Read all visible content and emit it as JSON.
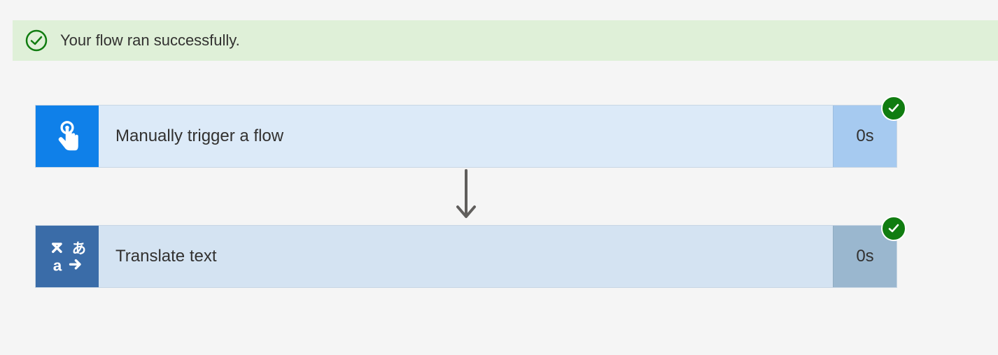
{
  "banner": {
    "message": "Your flow ran successfully."
  },
  "steps": [
    {
      "label": "Manually trigger a flow",
      "duration": "0s",
      "status": "success"
    },
    {
      "label": "Translate text",
      "duration": "0s",
      "status": "success"
    }
  ],
  "colors": {
    "success_green": "#107c10",
    "banner_bg": "#dff0d8",
    "card1_icon_bg": "#0f80e9",
    "card2_icon_bg": "#3a6ca8"
  }
}
